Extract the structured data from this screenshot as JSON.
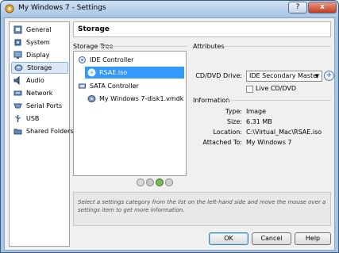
{
  "window": {
    "title": "My Windows 7 - Settings",
    "help_glyph": "?",
    "close_glyph": "x"
  },
  "sidebar": {
    "items": [
      {
        "label": "General"
      },
      {
        "label": "System"
      },
      {
        "label": "Display"
      },
      {
        "label": "Storage"
      },
      {
        "label": "Audio"
      },
      {
        "label": "Network"
      },
      {
        "label": "Serial Ports"
      },
      {
        "label": "USB"
      },
      {
        "label": "Shared Folders"
      }
    ],
    "selected": "Storage"
  },
  "header": {
    "title": "Storage"
  },
  "storage_tree": {
    "label": "Storage Tree",
    "ide_controller": "IDE Controller",
    "ide_item": "RSAE.iso",
    "sata_controller": "SATA Controller",
    "sata_item": "My Windows 7-disk1.vmdk"
  },
  "attributes": {
    "label": "Attributes",
    "drive_label": "CD/DVD Drive:",
    "drive_value": "IDE Secondary Master",
    "live_label": "Live CD/DVD",
    "live_checked": false
  },
  "information": {
    "label": "Information",
    "type_label": "Type:",
    "type_value": "Image",
    "size_label": "Size:",
    "size_value": "6.31 MB",
    "location_label": "Location:",
    "location_value": "C:\\Virtual_Mac\\RSAE.iso",
    "attached_label": "Attached To:",
    "attached_value": "My Windows 7"
  },
  "info_panel": {
    "text": "Select a settings category from the list on the left-hand side and move the mouse over a settings item to get more information."
  },
  "buttons": {
    "ok": "OK",
    "cancel": "Cancel",
    "help": "Help"
  },
  "colors": {
    "selection": "#3399ff",
    "frame": "#a8c4e0"
  }
}
